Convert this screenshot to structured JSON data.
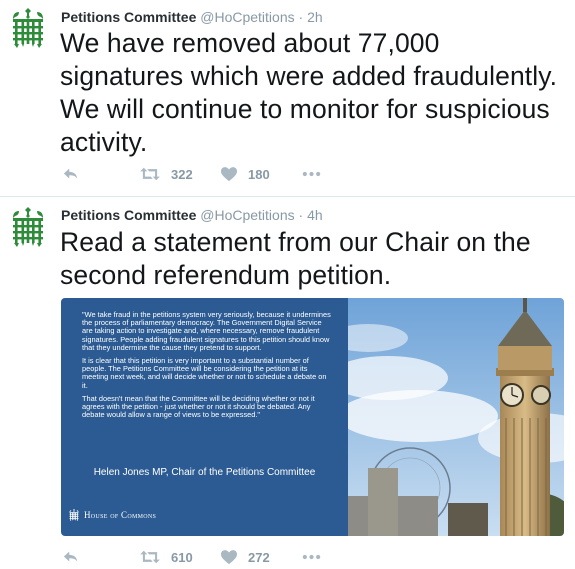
{
  "tweets": [
    {
      "author_name": "Petitions Committee",
      "handle": "@HoCpetitions",
      "separator": "·",
      "time": "2h",
      "text": "We have removed about 77,000 signatures which were added fraudulently. We will continue to monitor for suspicious activity.",
      "retweets": "322",
      "likes": "180"
    },
    {
      "author_name": "Petitions Committee",
      "handle": "@HoCpetitions",
      "separator": "·",
      "time": "4h",
      "text": "Read a statement from our Chair on the second referendum petition.",
      "retweets": "610",
      "likes": "272",
      "card": {
        "paragraph_1": "\"We take fraud in the petitions system very seriously, because it undermines the process of parliamentary democracy. The Government Digital Service are taking action to investigate and, where necessary, remove fraudulent signatures. People adding fraudulent signatures to this petition should know that they undermine the cause they pretend to support.",
        "paragraph_2": "It is clear that this petition is very important to a substantial number of people. The Petitions Committee will be considering the petition at its meeting next week, and will decide whether or not to schedule a debate on it.",
        "paragraph_3": "That doesn't mean that the Committee will be deciding whether or not it agrees with the petition - just whether or not it should be debated. Any debate would allow a range of views to be expressed.\"",
        "signature": "Helen Jones MP, Chair of the Petitions Committee",
        "logo_text": "House of Commons"
      }
    }
  ],
  "colors": {
    "text": "#14171a",
    "muted": "#8899a6",
    "icon": "#aab8c2",
    "card_blue": "#2b5b92",
    "portcullis_green": "#2e7d32",
    "sky": "#9fc3e6"
  },
  "icons": {
    "reply": "reply-icon",
    "retweet": "retweet-icon",
    "like": "heart-icon",
    "more": "more-icon",
    "avatar": "portcullis-icon"
  }
}
